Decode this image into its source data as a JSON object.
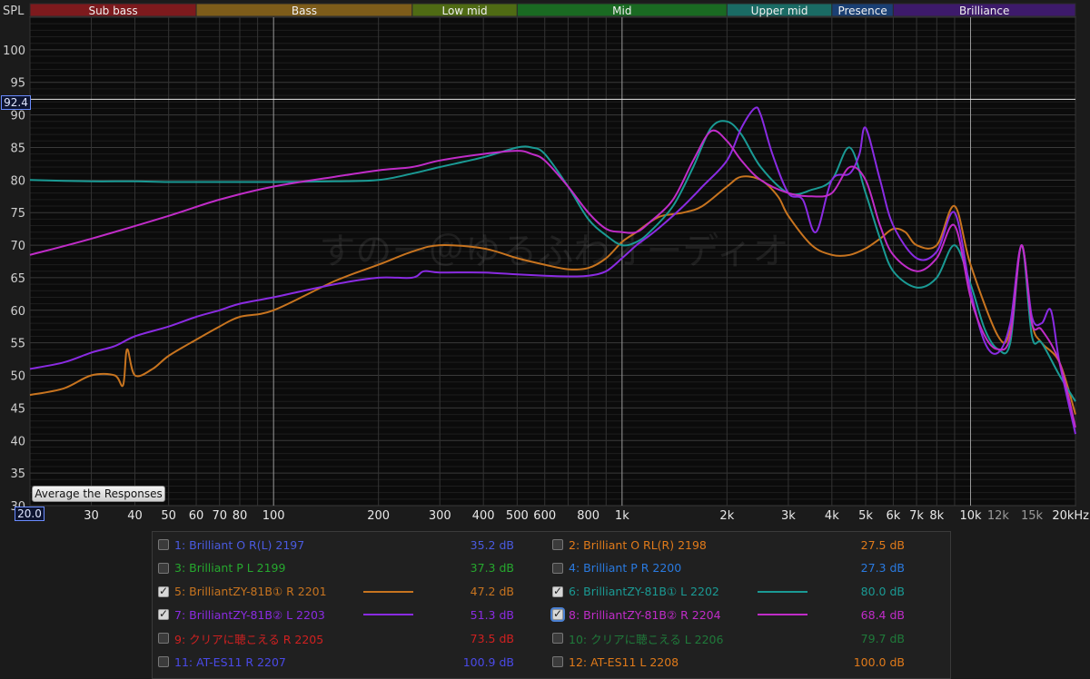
{
  "bands": [
    {
      "label": "Sub bass",
      "from": 20,
      "to": 60,
      "color": "#7d1a1d"
    },
    {
      "label": "Bass",
      "from": 60,
      "to": 250,
      "color": "#7d5c1a"
    },
    {
      "label": "Low mid",
      "from": 250,
      "to": 500,
      "color": "#4f6b14"
    },
    {
      "label": "Mid",
      "from": 500,
      "to": 2000,
      "color": "#1a6a22"
    },
    {
      "label": "Upper mid",
      "from": 2000,
      "to": 4000,
      "color": "#1a6b64"
    },
    {
      "label": "Presence",
      "from": 4000,
      "to": 6000,
      "color": "#1a3f73"
    },
    {
      "label": "Brilliance",
      "from": 6000,
      "to": 20000,
      "color": "#3d1a6b"
    }
  ],
  "axis": {
    "y_title": "SPL",
    "y_ticks": [
      "100",
      "95",
      "90",
      "85",
      "80",
      "75",
      "70",
      "65",
      "60",
      "55",
      "50",
      "45",
      "40",
      "35",
      "30"
    ],
    "x_ticks": [
      {
        "f": 30,
        "label": "30"
      },
      {
        "f": 40,
        "label": "40"
      },
      {
        "f": 50,
        "label": "50"
      },
      {
        "f": 60,
        "label": "60"
      },
      {
        "f": 70,
        "label": "70"
      },
      {
        "f": 80,
        "label": "80"
      },
      {
        "f": 100,
        "label": "100"
      },
      {
        "f": 200,
        "label": "200"
      },
      {
        "f": 300,
        "label": "300"
      },
      {
        "f": 400,
        "label": "400"
      },
      {
        "f": 500,
        "label": "500"
      },
      {
        "f": 600,
        "label": "600"
      },
      {
        "f": 800,
        "label": "800"
      },
      {
        "f": 1000,
        "label": "1k"
      },
      {
        "f": 2000,
        "label": "2k"
      },
      {
        "f": 3000,
        "label": "3k"
      },
      {
        "f": 4000,
        "label": "4k"
      },
      {
        "f": 5000,
        "label": "5k"
      },
      {
        "f": 6000,
        "label": "6k"
      },
      {
        "f": 7000,
        "label": "7k"
      },
      {
        "f": 8000,
        "label": "8k"
      },
      {
        "f": 10000,
        "label": "10k"
      },
      {
        "f": 12000,
        "label": "12k",
        "dim": true
      },
      {
        "f": 15000,
        "label": "15k",
        "dim": true
      },
      {
        "f": 20000,
        "label": "20kHz"
      }
    ],
    "spl_marker": "92.4",
    "freq_marker": "20.0"
  },
  "watermark": "すのー＠ゆるふわオーディオ",
  "average_button": "Average the Responses",
  "chart_data": {
    "type": "line",
    "x_scale": "log",
    "xlim": [
      20,
      20000
    ],
    "ylim": [
      30,
      105
    ],
    "ylabel": "SPL",
    "reference_line": 92.4,
    "series": [
      {
        "name": "5: BrilliantZY-81B①  R 2201",
        "color": "#c8741f",
        "x": [
          20,
          25,
          30,
          35,
          37,
          38,
          40,
          45,
          50,
          60,
          70,
          80,
          100,
          150,
          200,
          250,
          300,
          400,
          500,
          600,
          700,
          800,
          900,
          1000,
          1100,
          1200,
          1300,
          1500,
          1700,
          2000,
          2200,
          2500,
          2800,
          3000,
          3500,
          4000,
          4500,
          5000,
          5500,
          6000,
          6500,
          7000,
          8000,
          9000,
          10000,
          12000,
          13000,
          14000,
          15000,
          16000,
          18000,
          20000
        ],
        "y": [
          47,
          48,
          50,
          50,
          48.5,
          54,
          50,
          51,
          53,
          55.5,
          57.5,
          59,
          60,
          64.5,
          67,
          69,
          70,
          69.5,
          68,
          67,
          66.3,
          66.5,
          68,
          70.5,
          72,
          73.5,
          74.5,
          75,
          76,
          79,
          80.5,
          80,
          77.5,
          74.5,
          70,
          68.5,
          68.5,
          69.5,
          71,
          72.5,
          72,
          70,
          70,
          76,
          67,
          56,
          57,
          70,
          58,
          55,
          52,
          44
        ]
      },
      {
        "name": "6: BrilliantZY-81B①  L 2202",
        "color": "#1a9a94",
        "x": [
          20,
          30,
          40,
          50,
          70,
          100,
          150,
          200,
          250,
          300,
          400,
          500,
          550,
          600,
          700,
          800,
          900,
          1000,
          1100,
          1200,
          1400,
          1600,
          1800,
          2000,
          2200,
          2500,
          3000,
          3500,
          4000,
          4500,
          5000,
          5500,
          6000,
          7000,
          8000,
          9000,
          10000,
          11000,
          12000,
          13000,
          14000,
          15000,
          16000,
          18000,
          20000
        ],
        "y": [
          80,
          79.8,
          79.8,
          79.7,
          79.7,
          79.7,
          79.8,
          80,
          81,
          82,
          83.5,
          85,
          85,
          84,
          79,
          74,
          71.5,
          70,
          70.5,
          72,
          76,
          82,
          88,
          89,
          87,
          82,
          78,
          78.5,
          80,
          85,
          78,
          71,
          66,
          63.5,
          65,
          70,
          64,
          57,
          54,
          55,
          70,
          56,
          55,
          50,
          46
        ]
      },
      {
        "name": "7: BrilliantZY-81B②  L 2203",
        "color": "#8a2be2",
        "x": [
          20,
          25,
          30,
          35,
          40,
          50,
          60,
          70,
          80,
          100,
          150,
          200,
          250,
          270,
          300,
          400,
          500,
          600,
          700,
          800,
          900,
          1000,
          1100,
          1200,
          1300,
          1500,
          1700,
          2000,
          2200,
          2400,
          2500,
          2700,
          3000,
          3300,
          3600,
          4000,
          4500,
          4800,
          5000,
          5500,
          6000,
          7000,
          8000,
          9000,
          10000,
          11000,
          12000,
          13000,
          14000,
          15000,
          16000,
          17000,
          18000,
          20000
        ],
        "y": [
          51,
          52,
          53.5,
          54.5,
          56,
          57.5,
          59,
          60,
          61,
          62,
          64,
          65,
          65,
          66,
          65.8,
          65.8,
          65.5,
          65.3,
          65.2,
          65.3,
          66,
          68,
          70,
          71.5,
          73,
          76,
          79,
          83,
          88,
          91,
          90,
          84,
          78,
          77,
          72,
          80,
          81,
          84,
          88,
          80,
          73,
          68,
          69,
          75,
          63,
          55,
          53.5,
          58,
          70,
          59,
          58,
          60,
          52,
          41
        ]
      },
      {
        "name": "8: BrilliantZY-81B②  R 2204",
        "color": "#c02cc8",
        "x": [
          20,
          30,
          50,
          70,
          100,
          150,
          200,
          250,
          300,
          400,
          500,
          550,
          600,
          700,
          800,
          900,
          1000,
          1100,
          1200,
          1400,
          1600,
          1800,
          2000,
          2200,
          2500,
          3000,
          3500,
          4000,
          4500,
          5000,
          5500,
          6000,
          7000,
          8000,
          9000,
          10000,
          11000,
          12000,
          13000,
          14000,
          15000,
          16000,
          18000,
          20000
        ],
        "y": [
          68.5,
          71,
          74.5,
          77,
          79,
          80.5,
          81.5,
          82,
          83,
          84,
          84.5,
          84,
          83,
          79,
          75,
          72.5,
          72,
          72,
          73.5,
          77,
          83,
          87.5,
          86,
          83,
          80,
          78,
          77.5,
          78,
          82,
          80,
          73,
          68.5,
          66,
          68,
          73,
          62,
          56,
          54,
          56,
          70,
          58,
          57,
          52,
          42
        ]
      }
    ]
  },
  "legend": [
    {
      "id": "1",
      "label": "1: Brilliant O R(L) 2197",
      "db": "35.2 dB",
      "color": "#4a5ae0",
      "checked": false
    },
    {
      "id": "2",
      "label": "2: Brilliant O RL(R)  2198",
      "db": "27.5 dB",
      "color": "#e07a1a",
      "checked": false
    },
    {
      "id": "3",
      "label": "3: Brilliant P L 2199",
      "db": "37.3 dB",
      "color": "#26a82e",
      "checked": false
    },
    {
      "id": "4",
      "label": "4: Brilliant P R 2200",
      "db": "27.3 dB",
      "color": "#2a7ae0",
      "checked": false
    },
    {
      "id": "5",
      "label": "5: BrilliantZY-81B①  R 2201",
      "db": "47.2 dB",
      "color": "#c8741f",
      "checked": true,
      "line": true
    },
    {
      "id": "6",
      "label": "6: BrilliantZY-81B①  L 2202",
      "db": "80.0 dB",
      "color": "#1a9a94",
      "checked": true,
      "line": true
    },
    {
      "id": "7",
      "label": "7: BrilliantZY-81B②  L 2203",
      "db": "51.3 dB",
      "color": "#8a2be2",
      "checked": true,
      "line": true
    },
    {
      "id": "8",
      "label": "8: BrilliantZY-81B②  R 2204",
      "db": "68.4 dB",
      "color": "#c02cc8",
      "checked": true,
      "line": true,
      "focused": true
    },
    {
      "id": "9",
      "label": "9: クリアに聴こえる  R 2205",
      "db": "73.5 dB",
      "color": "#d02020",
      "checked": false
    },
    {
      "id": "10",
      "label": "10: クリアに聴こえる  L 2206",
      "db": "79.7 dB",
      "color": "#1f7a3a",
      "checked": false
    },
    {
      "id": "11",
      "label": "11: AT-ES11  R 2207",
      "db": "100.9 dB",
      "color": "#4a4ae8",
      "checked": false
    },
    {
      "id": "12",
      "label": "12: AT-ES11  L 2208",
      "db": "100.0 dB",
      "color": "#e07a1a",
      "checked": false
    }
  ]
}
